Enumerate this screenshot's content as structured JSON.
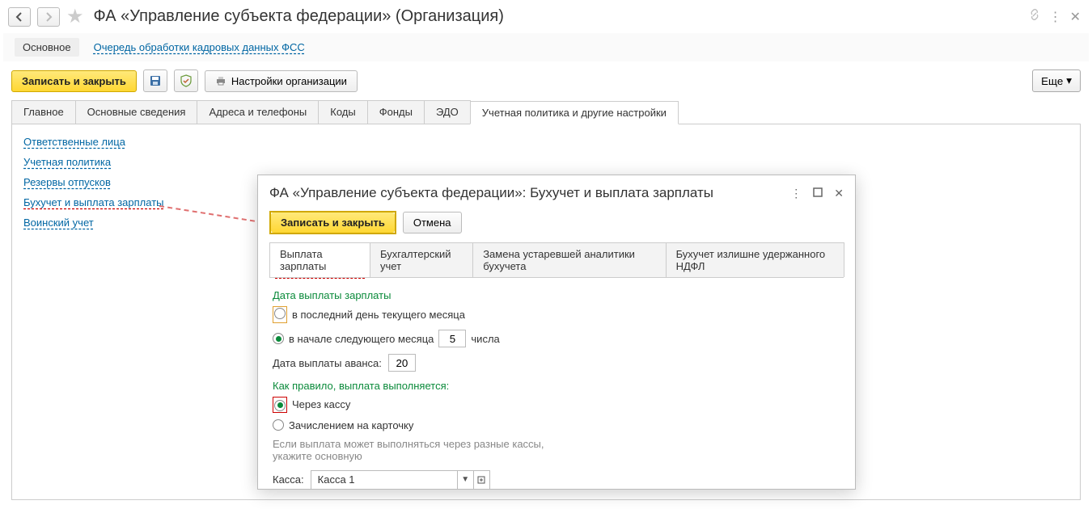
{
  "header": {
    "title": "ФА «Управление субъекта федерации» (Организация)"
  },
  "subnav": {
    "main": "Основное",
    "link1": "Очередь обработки кадровых данных ФСС"
  },
  "toolbar": {
    "save_close": "Записать и закрыть",
    "org_settings": "Настройки организации",
    "more": "Еще"
  },
  "tabs": [
    "Главное",
    "Основные сведения",
    "Адреса и телефоны",
    "Коды",
    "Фонды",
    "ЭДО",
    "Учетная политика и другие настройки"
  ],
  "active_tab": 6,
  "links": {
    "responsible": "Ответственные лица",
    "policy": "Учетная политика",
    "reserves": "Резервы отпусков",
    "accounting": "Бухучет и выплата зарплаты",
    "military": "Воинский учет"
  },
  "dialog": {
    "title": "ФА «Управление субъекта федерации»: Бухучет и выплата зарплаты",
    "save_close": "Записать и закрыть",
    "cancel": "Отмена",
    "tabs": [
      "Выплата зарплаты",
      "Бухгалтерский учет",
      "Замена устаревшей аналитики бухучета",
      "Бухучет излишне удержанного НДФЛ"
    ],
    "active_tab": 0,
    "salary_date_label": "Дата выплаты зарплаты",
    "radio_last_day": "в последний день текущего месяца",
    "radio_next_month": "в начале следующего месяца",
    "day_value": "5",
    "day_suffix": "числа",
    "advance_label": "Дата выплаты аванса:",
    "advance_value": "20",
    "method_label": "Как правило, выплата выполняется:",
    "radio_via_kassa": "Через кассу",
    "radio_via_card": "Зачислением на карточку",
    "hint": "Если выплата может выполняться через разные кассы, укажите основную",
    "kassa_label": "Касса:",
    "kassa_value": "Касса 1"
  }
}
